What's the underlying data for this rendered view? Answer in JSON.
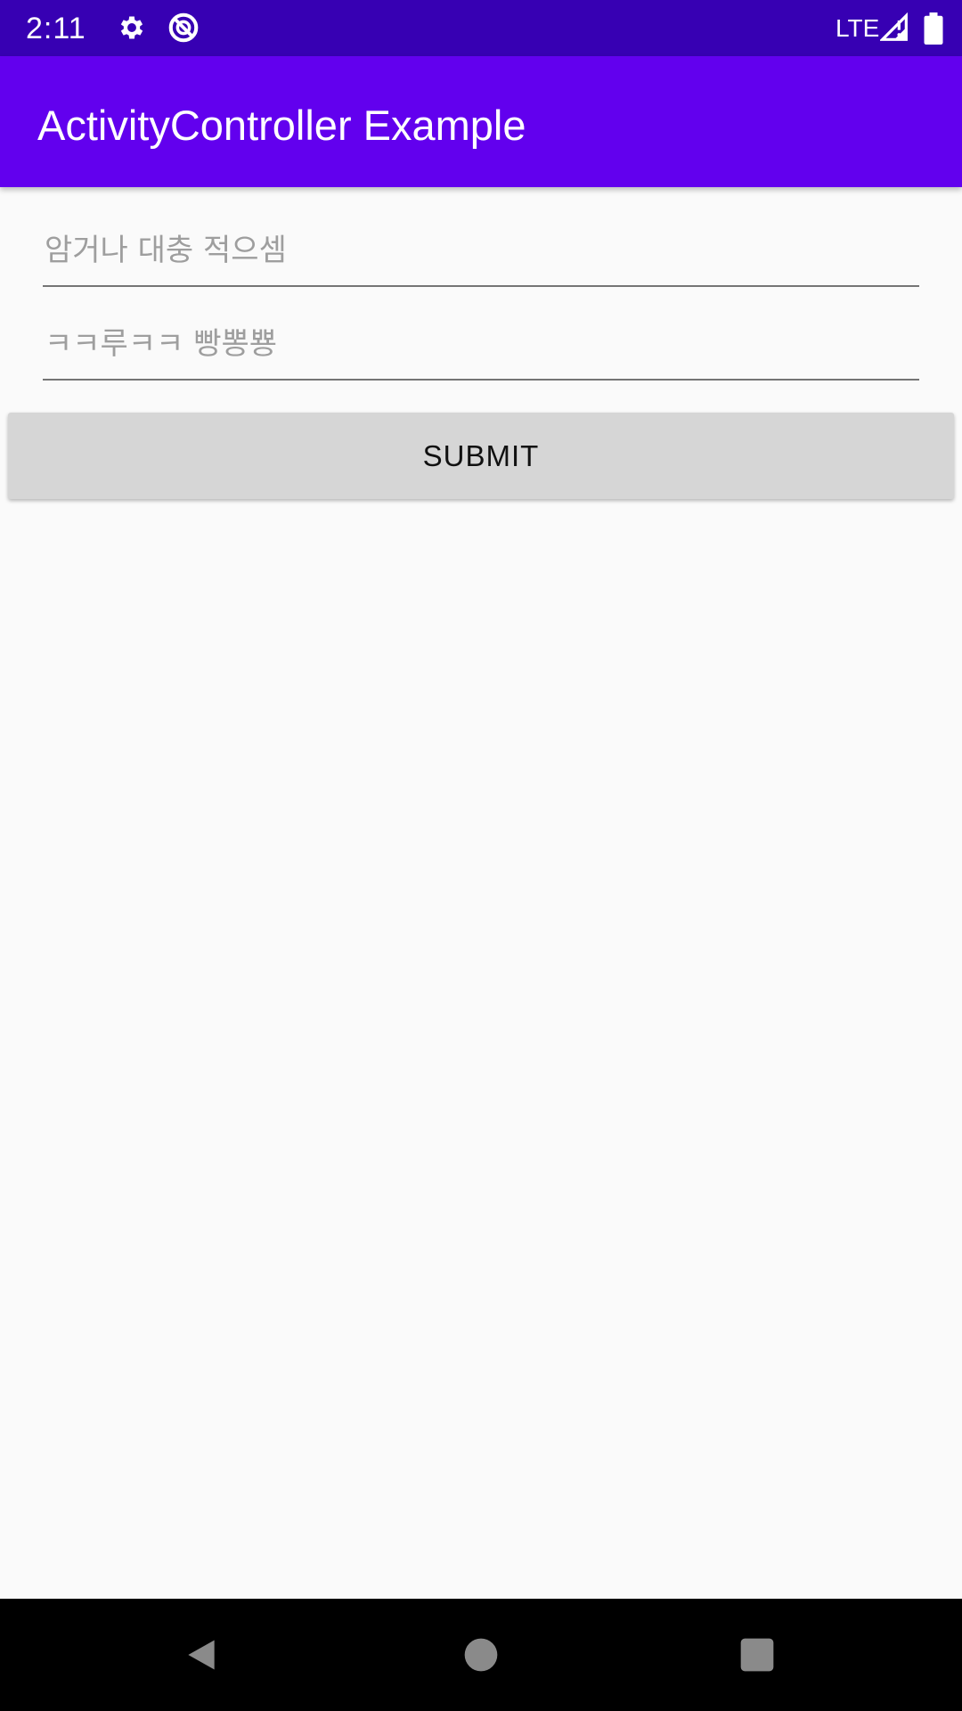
{
  "status_bar": {
    "time": "2:11",
    "network": "LTE",
    "icons": [
      "settings-icon",
      "do-not-disturb-icon",
      "signal-icon",
      "battery-icon"
    ]
  },
  "app_bar": {
    "title": "ActivityController Example",
    "color": "#6200ee"
  },
  "form": {
    "field1_placeholder": "암거나 대충 적으셈",
    "field2_placeholder": "ㅋㅋ루ㅋㅋ 빵뽕뿅",
    "submit_label": "SUBMIT"
  },
  "nav_bar": {
    "buttons": [
      "back-icon",
      "home-icon",
      "recents-icon"
    ]
  }
}
